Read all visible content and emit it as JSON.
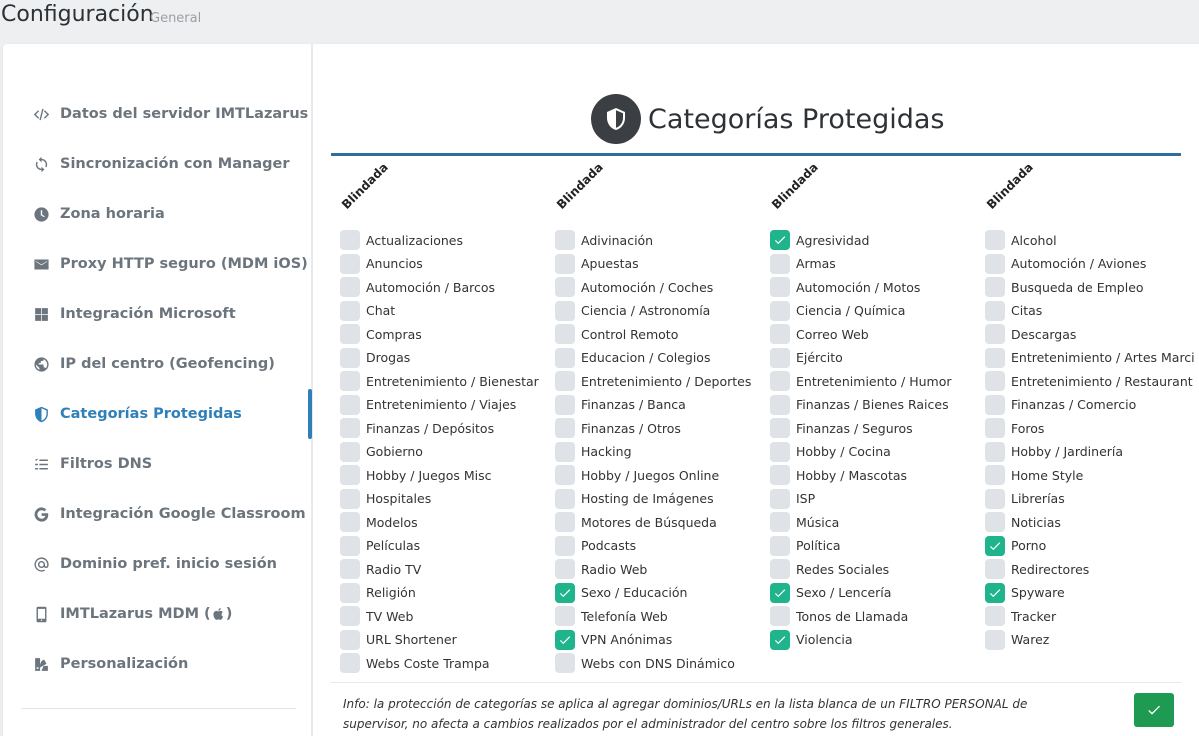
{
  "header": {
    "title": "Configuración",
    "subtitle": "General"
  },
  "sidebar": {
    "items": [
      {
        "label": "Datos del servidor IMTLazarus",
        "icon": "code-icon"
      },
      {
        "label": "Sincronización con Manager",
        "icon": "sync-icon"
      },
      {
        "label": "Zona horaria",
        "icon": "clock-icon"
      },
      {
        "label": "Proxy HTTP seguro (MDM iOS)",
        "icon": "envelope-icon"
      },
      {
        "label": "Integración Microsoft",
        "icon": "windows-icon"
      },
      {
        "label": "IP del centro (Geofencing)",
        "icon": "globe-icon"
      },
      {
        "label": "Categorías Protegidas",
        "icon": "shield-icon",
        "active": true
      },
      {
        "label": "Filtros DNS",
        "icon": "list-check-icon"
      },
      {
        "label": "Integración Google Classroom",
        "icon": "google-icon"
      },
      {
        "label": "Dominio pref. inicio sesión",
        "icon": "at-icon"
      },
      {
        "label": "IMTLazarus MDM (",
        "icon": "mobile-icon"
      },
      {
        "label": "Personalización",
        "icon": "paint-icon"
      }
    ]
  },
  "main": {
    "title": "Categorías Protegidas",
    "columns": [
      {
        "header": "Blindada",
        "items": [
          {
            "label": "Actualizaciones",
            "checked": false
          },
          {
            "label": "Anuncios",
            "checked": false
          },
          {
            "label": "Automoción / Barcos",
            "checked": false
          },
          {
            "label": "Chat",
            "checked": false
          },
          {
            "label": "Compras",
            "checked": false
          },
          {
            "label": "Drogas",
            "checked": false
          },
          {
            "label": "Entretenimiento / Bienestar",
            "checked": false
          },
          {
            "label": "Entretenimiento / Viajes",
            "checked": false
          },
          {
            "label": "Finanzas / Depósitos",
            "checked": false
          },
          {
            "label": "Gobierno",
            "checked": false
          },
          {
            "label": "Hobby / Juegos Misc",
            "checked": false
          },
          {
            "label": "Hospitales",
            "checked": false
          },
          {
            "label": "Modelos",
            "checked": false
          },
          {
            "label": "Películas",
            "checked": false
          },
          {
            "label": "Radio TV",
            "checked": false
          },
          {
            "label": "Religión",
            "checked": false
          },
          {
            "label": "TV Web",
            "checked": false
          },
          {
            "label": "URL Shortener",
            "checked": false
          },
          {
            "label": "Webs Coste Trampa",
            "checked": false
          }
        ]
      },
      {
        "header": "Blindada",
        "items": [
          {
            "label": "Adivinación",
            "checked": false
          },
          {
            "label": "Apuestas",
            "checked": false
          },
          {
            "label": "Automoción / Coches",
            "checked": false
          },
          {
            "label": "Ciencia / Astronomía",
            "checked": false
          },
          {
            "label": "Control Remoto",
            "checked": false
          },
          {
            "label": "Educacion / Colegios",
            "checked": false
          },
          {
            "label": "Entretenimiento / Deportes",
            "checked": false
          },
          {
            "label": "Finanzas / Banca",
            "checked": false
          },
          {
            "label": "Finanzas / Otros",
            "checked": false
          },
          {
            "label": "Hacking",
            "checked": false
          },
          {
            "label": "Hobby / Juegos Online",
            "checked": false
          },
          {
            "label": "Hosting de Imágenes",
            "checked": false
          },
          {
            "label": "Motores de Búsqueda",
            "checked": false
          },
          {
            "label": "Podcasts",
            "checked": false
          },
          {
            "label": "Radio Web",
            "checked": false
          },
          {
            "label": "Sexo / Educación",
            "checked": true
          },
          {
            "label": "Telefonía Web",
            "checked": false
          },
          {
            "label": "VPN Anónimas",
            "checked": true
          },
          {
            "label": "Webs con DNS Dinámico",
            "checked": false
          }
        ]
      },
      {
        "header": "Blindada",
        "items": [
          {
            "label": "Agresividad",
            "checked": true
          },
          {
            "label": "Armas",
            "checked": false
          },
          {
            "label": "Automoción / Motos",
            "checked": false
          },
          {
            "label": "Ciencia / Química",
            "checked": false
          },
          {
            "label": "Correo Web",
            "checked": false
          },
          {
            "label": "Ejército",
            "checked": false
          },
          {
            "label": "Entretenimiento / Humor",
            "checked": false
          },
          {
            "label": "Finanzas / Bienes Raices",
            "checked": false
          },
          {
            "label": "Finanzas / Seguros",
            "checked": false
          },
          {
            "label": "Hobby / Cocina",
            "checked": false
          },
          {
            "label": "Hobby / Mascotas",
            "checked": false
          },
          {
            "label": "ISP",
            "checked": false
          },
          {
            "label": "Música",
            "checked": false
          },
          {
            "label": "Política",
            "checked": false
          },
          {
            "label": "Redes Sociales",
            "checked": false
          },
          {
            "label": "Sexo / Lencería",
            "checked": true
          },
          {
            "label": "Tonos de Llamada",
            "checked": false
          },
          {
            "label": "Violencia",
            "checked": true
          }
        ]
      },
      {
        "header": "Blindada",
        "items": [
          {
            "label": "Alcohol",
            "checked": false
          },
          {
            "label": "Automoción / Aviones",
            "checked": false
          },
          {
            "label": "Busqueda de Empleo",
            "checked": false
          },
          {
            "label": "Citas",
            "checked": false
          },
          {
            "label": "Descargas",
            "checked": false
          },
          {
            "label": "Entretenimiento / Artes Marci",
            "checked": false
          },
          {
            "label": "Entretenimiento / Restaurant",
            "checked": false
          },
          {
            "label": "Finanzas / Comercio",
            "checked": false
          },
          {
            "label": "Foros",
            "checked": false
          },
          {
            "label": "Hobby / Jardinería",
            "checked": false
          },
          {
            "label": "Home Style",
            "checked": false
          },
          {
            "label": "Librerías",
            "checked": false
          },
          {
            "label": "Noticias",
            "checked": false
          },
          {
            "label": "Porno",
            "checked": true
          },
          {
            "label": "Redirectores",
            "checked": false
          },
          {
            "label": "Spyware",
            "checked": true
          },
          {
            "label": "Tracker",
            "checked": false
          },
          {
            "label": "Warez",
            "checked": false
          }
        ]
      }
    ],
    "info": "Info: la protección de categorías se aplica al agregar dominios/URLs en la lista blanca de un FILTRO PERSONAL de supervisor, no afecta a cambios realizados por el administrador del centro sobre los filtros generales.",
    "save_icon": "check-icon"
  },
  "colors": {
    "accent": "#2f7fb8",
    "checked": "#20b48c",
    "save": "#1f9a52",
    "rule": "#2d6f9a"
  }
}
